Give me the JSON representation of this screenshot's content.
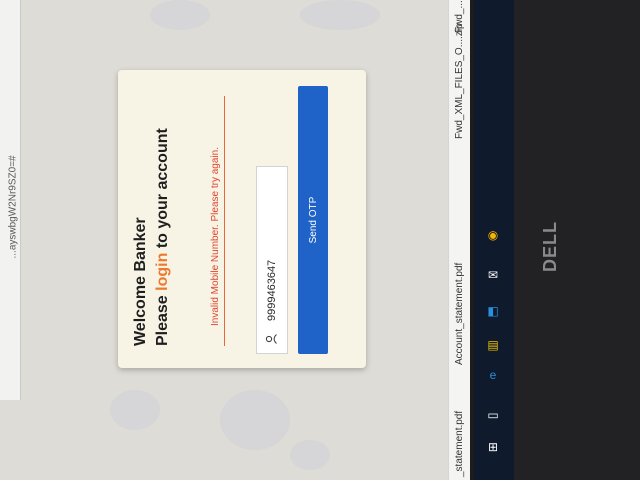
{
  "browser": {
    "url_fragment": "...ayswbgW2Nr9SZ0=#"
  },
  "login_card": {
    "welcome": "Welcome Banker",
    "login_prefix": "Please ",
    "login_word": "login",
    "login_suffix": " to your account",
    "error": "Invalid Mobile Number. Please try again.",
    "mobile_value": "9999463647",
    "send_otp_label": "Send OTP"
  },
  "downloads": [
    {
      "label": "_statement.pdf"
    },
    {
      "label": "Account_statement.pdf"
    },
    {
      "label": "Fwd_XML_FILES_O....zip"
    },
    {
      "label": "Fwd_..."
    }
  ],
  "taskbar_icons": [
    "windows-icon",
    "task-view-icon",
    "edge-icon",
    "file-explorer-icon",
    "store-icon",
    "mail-icon",
    "chrome-icon"
  ],
  "device": {
    "brand": "DELL"
  },
  "colors": {
    "accent_orange": "#f0782c",
    "error_red": "#e2452d",
    "button_blue": "#1f63c8"
  }
}
